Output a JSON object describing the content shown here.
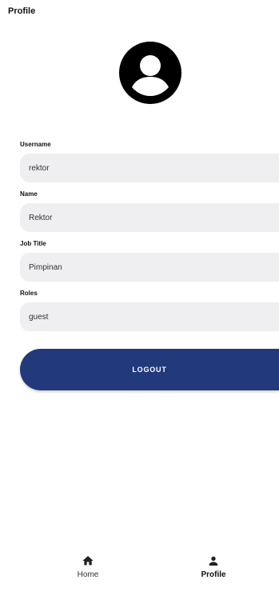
{
  "header": {
    "title": "Profile"
  },
  "avatar": {
    "icon": "account-circle-icon"
  },
  "form": {
    "username": {
      "label": "Username",
      "value": "rektor"
    },
    "name": {
      "label": "Name",
      "value": "Rektor"
    },
    "job_title": {
      "label": "Job Title",
      "value": "Pimpinan"
    },
    "roles": {
      "label": "Roles",
      "value": "guest"
    }
  },
  "actions": {
    "logout_label": "LOGOUT"
  },
  "bottom_nav": {
    "items": [
      {
        "label": "Home",
        "icon": "home-icon",
        "active": false
      },
      {
        "label": "Profile",
        "icon": "person-icon",
        "active": true
      }
    ]
  },
  "colors": {
    "primary": "#223a7c",
    "input_bg": "#efeff1",
    "text": "#111111"
  }
}
